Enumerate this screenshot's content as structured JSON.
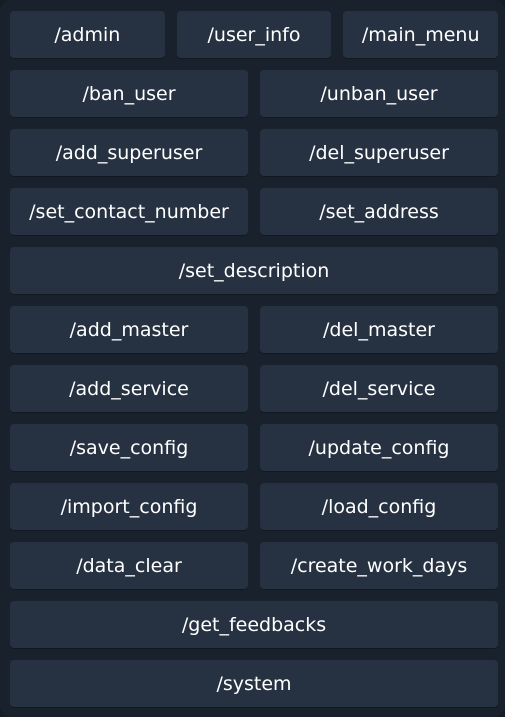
{
  "keyboard": {
    "rows": [
      [
        "/admin",
        "/user_info",
        "/main_menu"
      ],
      [
        "/ban_user",
        "/unban_user"
      ],
      [
        "/add_superuser",
        "/del_superuser"
      ],
      [
        "/set_contact_number",
        "/set_address"
      ],
      [
        "/set_description"
      ],
      [
        "/add_master",
        "/del_master"
      ],
      [
        "/add_service",
        "/del_service"
      ],
      [
        "/save_config",
        "/update_config"
      ],
      [
        "/import_config",
        "/load_config"
      ],
      [
        "/data_clear",
        "/create_work_days"
      ],
      [
        "/get_feedbacks"
      ],
      [
        "/system"
      ]
    ]
  },
  "colors": {
    "background": "#18212c",
    "button": "#263241",
    "text": "#ffffff"
  }
}
